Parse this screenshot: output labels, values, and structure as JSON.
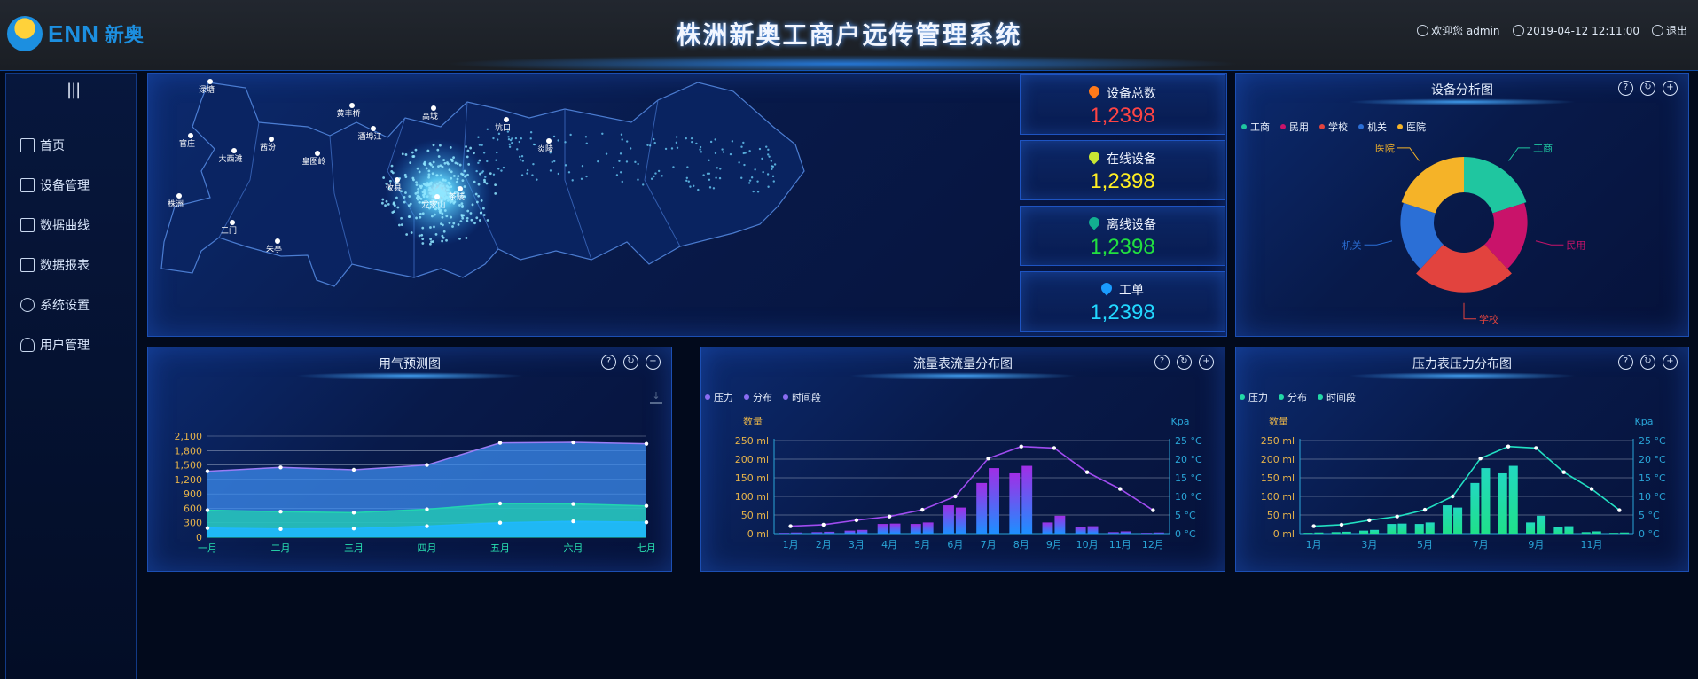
{
  "header": {
    "logo_text": "ENN",
    "logo_cn": "新奥",
    "title": "株洲新奥工商户远传管理系统",
    "welcome": "欢迎您 admin",
    "datetime": "2019-04-12 12:11:00",
    "logout": "退出"
  },
  "sidebar": {
    "toggle": "|||",
    "items": [
      {
        "label": "首页",
        "icon": "home-icon"
      },
      {
        "label": "设备管理",
        "icon": "device-icon"
      },
      {
        "label": "数据曲线",
        "icon": "curve-icon"
      },
      {
        "label": "数据报表",
        "icon": "report-icon"
      },
      {
        "label": "系统设置",
        "icon": "gear-icon"
      },
      {
        "label": "用户管理",
        "icon": "user-icon"
      }
    ]
  },
  "map": {
    "places": [
      "渌塘",
      "黄丰桥",
      "酒埠江",
      "高垅",
      "坑口",
      "炎陵",
      "官庄",
      "大西滩",
      "茜汾",
      "皇图岭",
      "攸县",
      "龙家山",
      "茶陵",
      "株洲",
      "三门",
      "朱亭"
    ]
  },
  "stats": [
    {
      "label": "设备总数",
      "value": "1,2398",
      "color": "#ff4444",
      "pin": "#ff7a1a"
    },
    {
      "label": "在线设备",
      "value": "1,2398",
      "color": "#ffee22",
      "pin": "#c8e633"
    },
    {
      "label": "离线设备",
      "value": "1,2398",
      "color": "#22e040",
      "pin": "#12b090"
    },
    {
      "label": "工单",
      "value": "1,2398",
      "color": "#22d8ff",
      "pin": "#1a9cff"
    }
  ],
  "device_panel": {
    "title": "设备分析图",
    "chart_data": {
      "type": "pie",
      "categories": [
        "工商",
        "民用",
        "学校",
        "机关",
        "医院"
      ],
      "values": [
        20,
        18,
        24,
        18,
        20
      ],
      "colors": [
        "#1fc6a0",
        "#c9136a",
        "#e2433e",
        "#2b6fd6",
        "#f5b328"
      ]
    }
  },
  "gas_panel": {
    "title": "用气预测图",
    "chart_data": {
      "type": "area",
      "categories": [
        "一月",
        "二月",
        "三月",
        "四月",
        "五月",
        "六月",
        "七月"
      ],
      "series": [
        {
          "values": [
            1370,
            1450,
            1400,
            1500,
            1960,
            1970,
            1940
          ],
          "color": "#2f7df0"
        },
        {
          "values": [
            560,
            530,
            510,
            580,
            700,
            690,
            650
          ],
          "color": "#21d6b0"
        },
        {
          "values": [
            190,
            170,
            180,
            230,
            300,
            330,
            310
          ],
          "color": "#1fb8ff"
        }
      ],
      "yticks": [
        "0",
        "300",
        "600",
        "900",
        "1,200",
        "1,500",
        "1,800",
        "2,100"
      ],
      "ylim": [
        0,
        2100
      ]
    }
  },
  "flow_panel": {
    "title": "流量表流量分布图",
    "legend": [
      "压力",
      "分布",
      "时间段"
    ],
    "ylabel_left": "数量",
    "ylabel_right": "Kpa",
    "chart_data": {
      "type": "bar",
      "categories": [
        "1月",
        "2月",
        "3月",
        "4月",
        "5月",
        "6月",
        "7月",
        "8月",
        "9月",
        "10月",
        "11月",
        "12月"
      ],
      "series": [
        {
          "values": [
            2,
            4,
            8,
            26,
            26,
            76,
            136,
            162,
            30,
            18,
            4,
            2
          ]
        },
        {
          "values": [
            3,
            5,
            10,
            27,
            30,
            70,
            176,
            182,
            48,
            20,
            6,
            3
          ]
        }
      ],
      "line": [
        2,
        2.4,
        3.6,
        4.6,
        6.4,
        10,
        20.2,
        23.4,
        23,
        16.5,
        12,
        6.3
      ],
      "yticks_left": [
        "0 ml",
        "50 ml",
        "100 ml",
        "150 ml",
        "200 ml",
        "250 ml"
      ],
      "yticks_right": [
        "0 °C",
        "5 °C",
        "10 °C",
        "15 °C",
        "20 °C",
        "25 °C"
      ],
      "ylim": [
        0,
        250
      ]
    }
  },
  "pressure_panel": {
    "title": "压力表压力分布图",
    "legend": [
      "压力",
      "分布",
      "时间段"
    ],
    "ylabel_left": "数量",
    "ylabel_right": "Kpa",
    "chart_data": {
      "type": "bar",
      "categories": [
        "1月",
        "3月",
        "5月",
        "7月",
        "9月",
        "11月"
      ],
      "series": [
        {
          "values": [
            2,
            4,
            8,
            26,
            26,
            76,
            136,
            162,
            30,
            18,
            4,
            2
          ]
        },
        {
          "values": [
            3,
            5,
            10,
            27,
            30,
            70,
            176,
            182,
            48,
            20,
            6,
            3
          ]
        }
      ],
      "line": [
        2,
        2.4,
        3.6,
        4.6,
        6.4,
        10,
        20.2,
        23.4,
        23,
        16.5,
        12,
        6.3
      ],
      "yticks_left": [
        "0 ml",
        "50 ml",
        "100 ml",
        "150 ml",
        "200 ml",
        "250 ml"
      ],
      "yticks_right": [
        "0 °C",
        "5 °C",
        "10 °C",
        "15 °C",
        "20 °C",
        "25 °C"
      ],
      "ylim": [
        0,
        250
      ]
    }
  }
}
